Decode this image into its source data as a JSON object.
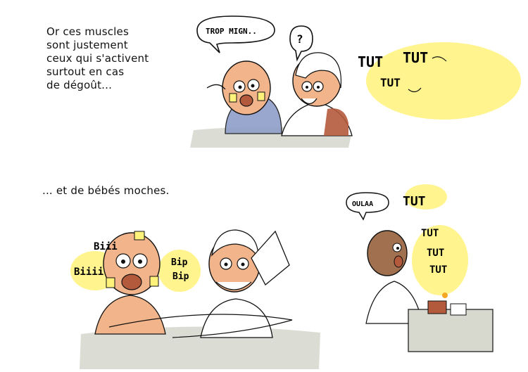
{
  "panel1": {
    "caption": "Or ces muscles\nsont justement\nceux qui s'activent\nsurtout en cas\nde dégoût...",
    "speech": "TROP MIGN..",
    "question": "?",
    "tut_top": [
      "TUT",
      "TUT",
      "TUT"
    ]
  },
  "panel2": {
    "caption": "... et de bébés moches.",
    "sounds": [
      "Biii",
      "Biiii",
      "Bip",
      "Bip"
    ]
  },
  "panel3": {
    "speech": "OULAA",
    "tut": [
      "TUT",
      "TUT",
      "TUT",
      "TUT"
    ]
  },
  "colors": {
    "yellow_glow": "#fff27a",
    "skin": "#f2b48a",
    "ground": "#d7d9cf",
    "blue_shirt": "#8f9ec9",
    "rust": "#b45a3c"
  }
}
